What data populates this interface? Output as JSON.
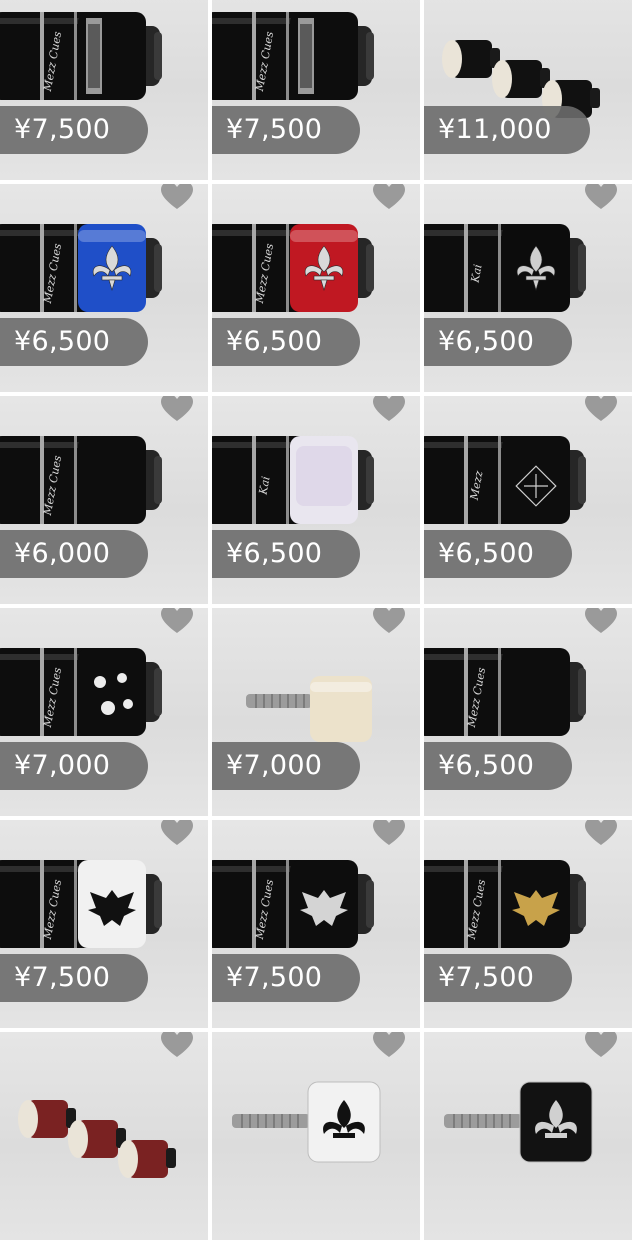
{
  "products": [
    {
      "price": "¥7,500",
      "art": "cue",
      "band": "chrome-engraved",
      "logo": "Mezz Cues"
    },
    {
      "price": "¥7,500",
      "art": "cue",
      "band": "chrome-ornate",
      "logo": "Mezz Cues"
    },
    {
      "price": "¥11,000",
      "art": "tips-trio",
      "color": "#111111"
    },
    {
      "price": "¥6,500",
      "art": "cue",
      "band": "blue-fleur",
      "color": "#1f4fc8",
      "logo": "Mezz Cues"
    },
    {
      "price": "¥6,500",
      "art": "cue",
      "band": "red-fleur",
      "color": "#c01822",
      "logo": "Mezz Cues"
    },
    {
      "price": "¥6,500",
      "art": "cue",
      "band": "black-fleur",
      "logo": "Kai"
    },
    {
      "price": "¥6,000",
      "art": "cue",
      "band": "plain",
      "logo": "Mezz Cues"
    },
    {
      "price": "¥6,500",
      "art": "cue",
      "band": "pearl",
      "logo": "Kai"
    },
    {
      "price": "¥6,500",
      "art": "cue",
      "band": "cross-pattern",
      "logo": "Mezz"
    },
    {
      "price": "¥7,000",
      "art": "cue",
      "band": "sakura",
      "logo": "Mezz Cues"
    },
    {
      "price": "¥7,000",
      "art": "screw-cap",
      "color": "#ece2cb"
    },
    {
      "price": "¥6,500",
      "art": "cue",
      "band": "crescent",
      "logo": "Mezz Cues"
    },
    {
      "price": "¥7,500",
      "art": "cue",
      "band": "white-eagle",
      "logo": "Mezz Cues"
    },
    {
      "price": "¥7,500",
      "art": "cue",
      "band": "silver-eagle",
      "logo": "Mezz Cues"
    },
    {
      "price": "¥7,500",
      "art": "cue",
      "band": "gold-eagle",
      "logo": "Mezz Cues"
    },
    {
      "price": "",
      "art": "tips-trio",
      "color": "#7a2222"
    },
    {
      "price": "",
      "art": "screw-fleur",
      "color": "#f2f2f2"
    },
    {
      "price": "",
      "art": "screw-fleur",
      "color": "#121212"
    }
  ],
  "icons": {
    "favorite": "heart-icon"
  },
  "colors": {
    "price_badge": "#6c6c6c",
    "heart": "#9a9a9a",
    "background": "#ffffff"
  }
}
